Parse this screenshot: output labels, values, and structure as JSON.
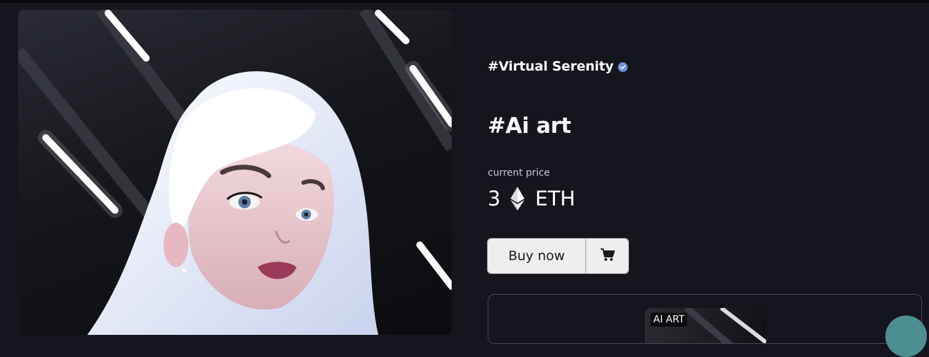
{
  "nft": {
    "creator": "#Virtual Serenity",
    "title": "#Ai art",
    "price_label": "current price",
    "price_amount": "3",
    "price_currency": "ETH"
  },
  "actions": {
    "buy_label": "Buy now",
    "cart_icon": "cart-icon"
  },
  "related": {
    "badge": "AI ART"
  },
  "colors": {
    "background": "#15151d",
    "verified": "#6f8fd8",
    "button": "#eeeeee"
  }
}
